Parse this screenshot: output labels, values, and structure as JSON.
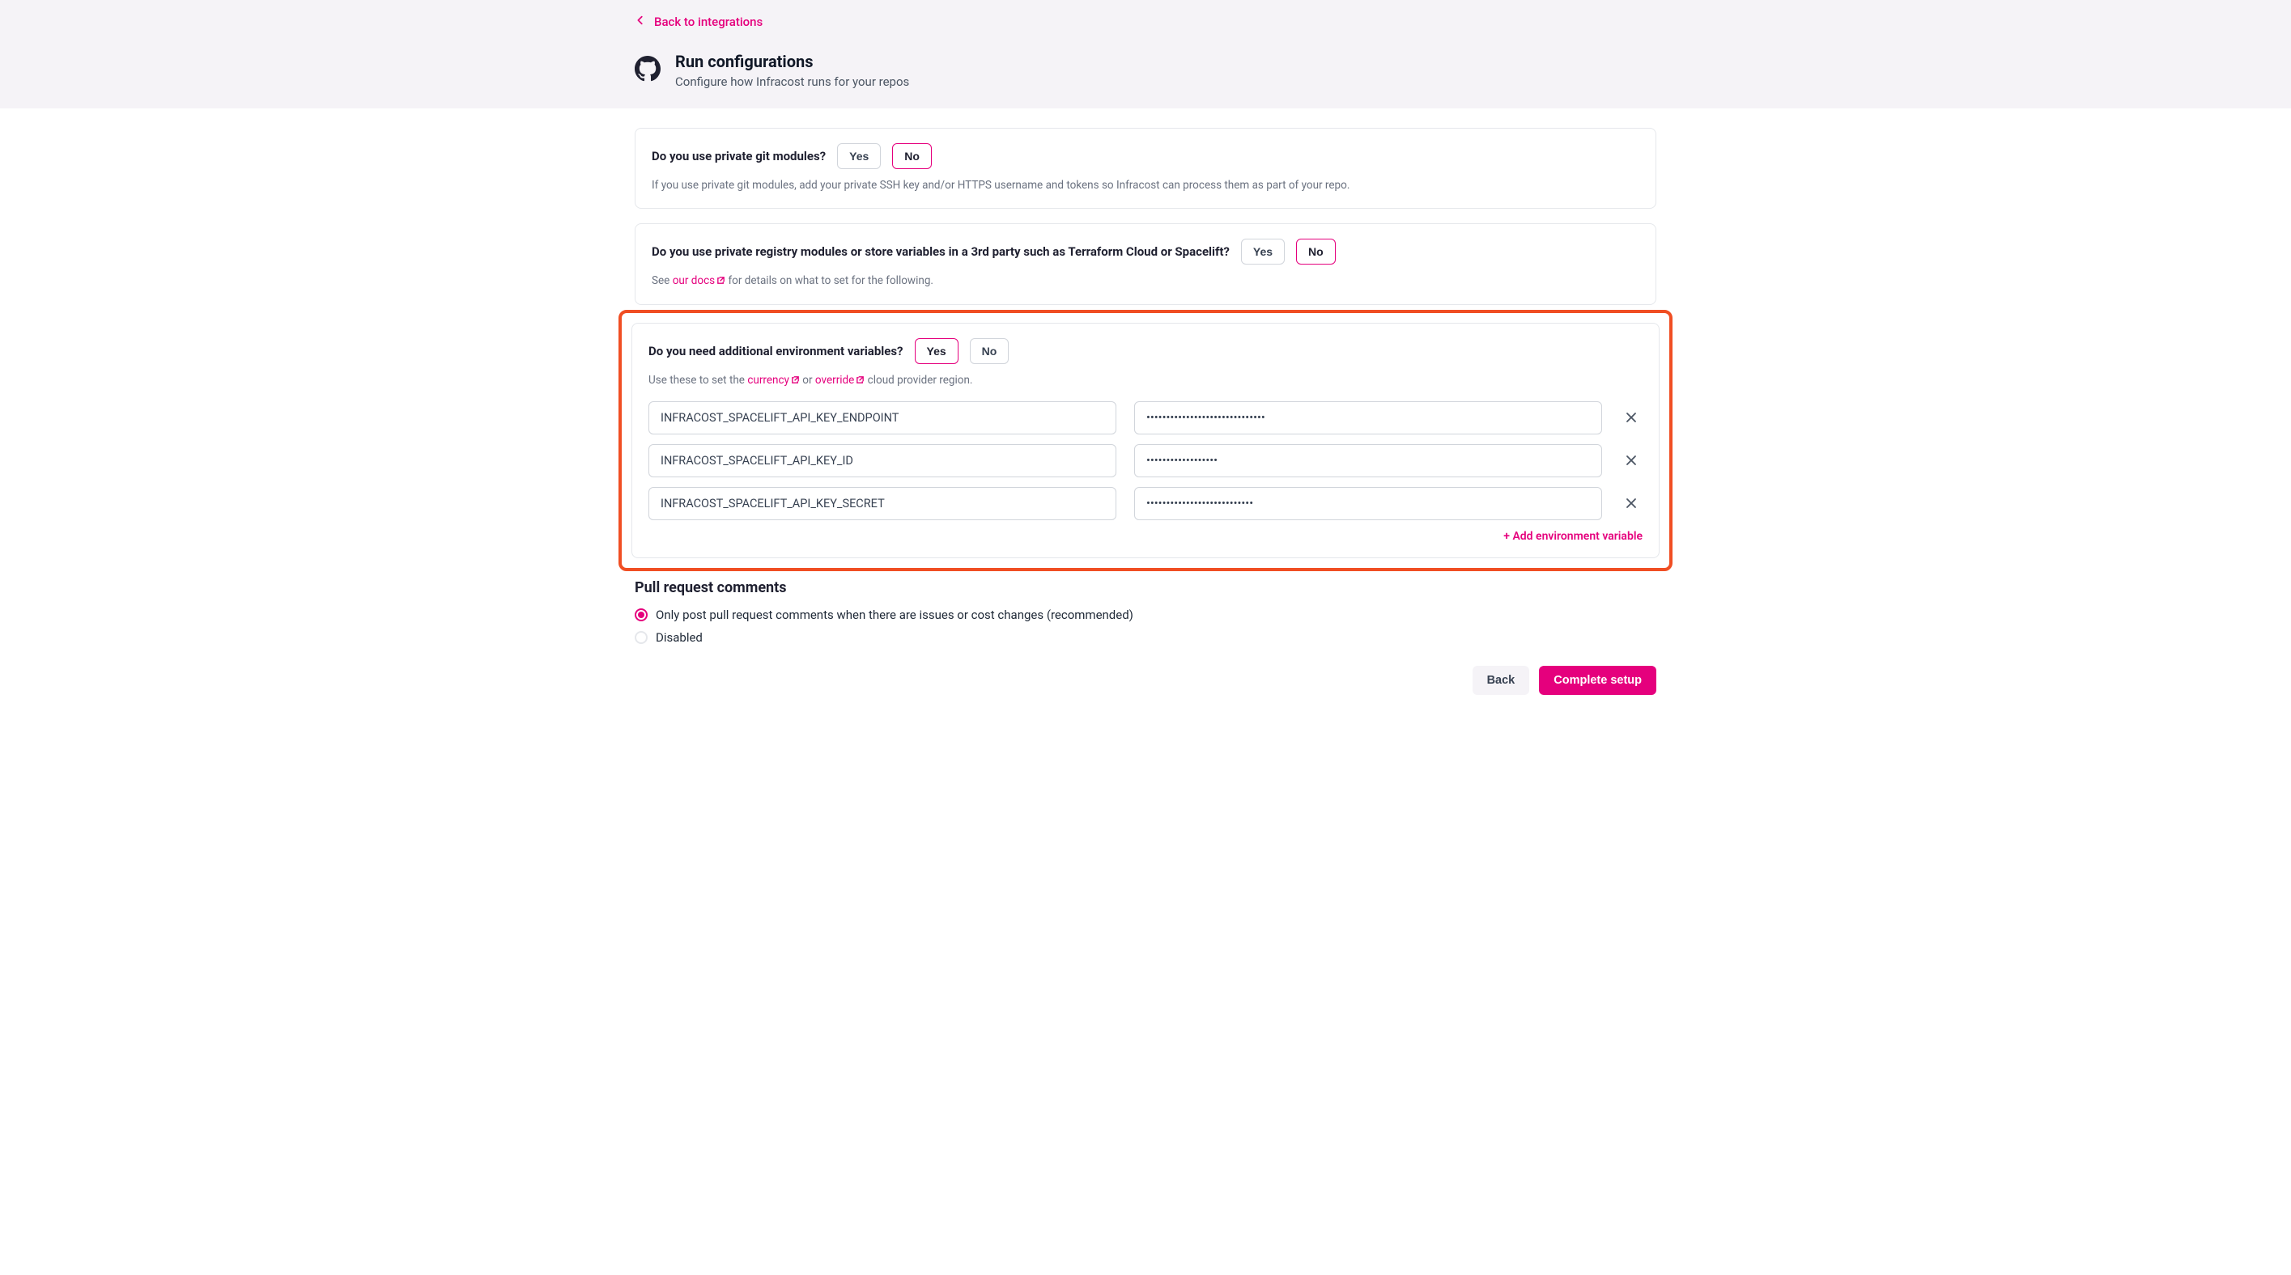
{
  "back_link": "Back to integrations",
  "page_title": "Run configurations",
  "page_subtitle": "Configure how Infracost runs for your repos",
  "card_git": {
    "question": "Do you use private git modules?",
    "yes": "Yes",
    "no": "No",
    "selected": "No",
    "help": "If you use private git modules, add your private SSH key and/or HTTPS username and tokens so Infracost can process them as part of your repo."
  },
  "card_registry": {
    "question": "Do you use private registry modules or store variables in a 3rd party such as Terraform Cloud or Spacelift?",
    "yes": "Yes",
    "no": "No",
    "selected": "No",
    "help_prefix": "See ",
    "docs_link": "our docs",
    "help_suffix": " for details on what to set for the following."
  },
  "card_env": {
    "question": "Do you need additional environment variables?",
    "yes": "Yes",
    "no": "No",
    "selected": "Yes",
    "help_prefix": "Use these to set the ",
    "currency_link": "currency",
    "help_mid": " or ",
    "override_link": "override",
    "help_suffix": " cloud provider region.",
    "rows": [
      {
        "key": "INFRACOST_SPACELIFT_API_KEY_ENDPOINT",
        "value": "••••••••••••••••••••••••••••••"
      },
      {
        "key": "INFRACOST_SPACELIFT_API_KEY_ID",
        "value": "••••••••••••••••••"
      },
      {
        "key": "INFRACOST_SPACELIFT_API_KEY_SECRET",
        "value": "•••••••••••••••••••••••••••"
      }
    ],
    "add_label": "+ Add environment variable"
  },
  "pr_section": {
    "title": "Pull request comments",
    "option_recommended": "Only post pull request comments when there are issues or cost changes (recommended)",
    "option_disabled": "Disabled",
    "selected": "recommended"
  },
  "footer": {
    "back": "Back",
    "complete": "Complete setup"
  }
}
